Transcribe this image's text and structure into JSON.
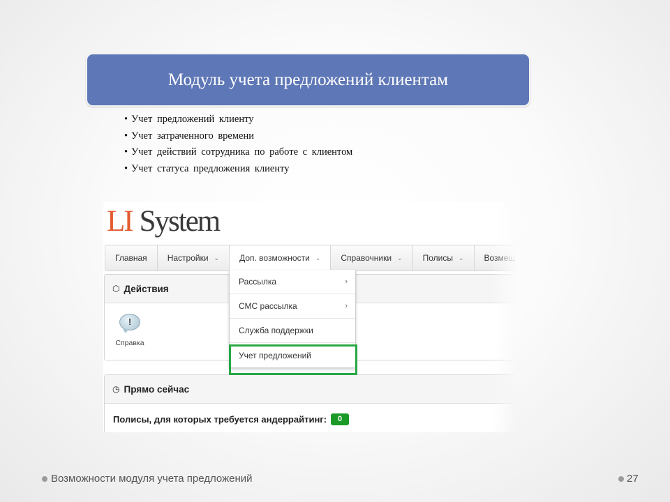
{
  "slide": {
    "title": "Модуль учета предложений клиентам",
    "bullets": [
      "Учет предложений клиенту",
      "Учет затраченного времени",
      "Учет действий сотрудника по работе с клиентом",
      "Учет статуса предложения клиенту"
    ],
    "footer_text": "Возможности модуля учета предложений",
    "page_number": "27"
  },
  "app": {
    "logo_li": "LI",
    "logo_system": "System",
    "nav": [
      {
        "label": "Главная",
        "has_caret": false
      },
      {
        "label": "Настройки",
        "has_caret": true
      },
      {
        "label": "Доп. возможности",
        "has_caret": true,
        "active": true
      },
      {
        "label": "Справочники",
        "has_caret": true
      },
      {
        "label": "Полисы",
        "has_caret": true
      },
      {
        "label": "Возмещ",
        "has_caret": false
      }
    ],
    "dropdown": [
      {
        "label": "Рассылка",
        "submenu": true
      },
      {
        "label": "СМС рассылка",
        "submenu": true
      },
      {
        "label": "Служба поддержки",
        "submenu": false
      },
      {
        "label": "Учет предложений",
        "submenu": false,
        "highlighted": true
      }
    ],
    "actions_panel": {
      "title": "Действия",
      "icon": "cube-icon",
      "tile_label": "Справка",
      "tile_icon": "help-bubble-icon",
      "tile_glyph": "!"
    },
    "now_panel": {
      "title": "Прямо сейчас",
      "icon": "clock-icon",
      "underwriting_label": "Полисы, для которых требуется андеррайтинг:",
      "underwriting_count": "0"
    }
  },
  "colors": {
    "title_box": "#5e77b6",
    "logo_accent": "#e35b30",
    "highlight_frame": "#27a844",
    "badge": "#1c9a27"
  }
}
